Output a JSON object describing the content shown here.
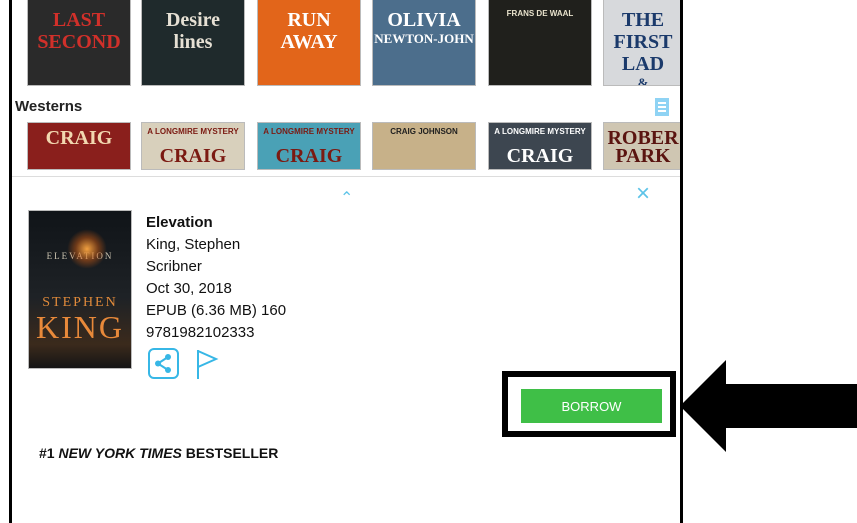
{
  "top_row": [
    {
      "lines": [
        "LAST",
        "SECOND"
      ],
      "bg": "#2a2a2a",
      "fg": "#d1302a"
    },
    {
      "lines": [
        "Desire",
        "lines"
      ],
      "bg": "#1f2a2c",
      "fg": "#e6e0d4"
    },
    {
      "lines": [
        "RUN",
        "AWAY"
      ],
      "bg": "#e2651a",
      "fg": "#ffffff"
    },
    {
      "lines": [
        "OLIVIA",
        "NEWTON-JOHN"
      ],
      "bg": "#4c6e8c",
      "fg": "#ffffff"
    },
    {
      "lines": [
        "FRANS DE WAAL"
      ],
      "bg": "#20201c",
      "fg": "#e8e2cc"
    },
    {
      "lines": [
        "THE",
        "FIRST",
        "LAD",
        "& BRENDAN"
      ],
      "bg": "#d7d9dc",
      "fg": "#1b3a6b"
    }
  ],
  "shelf": {
    "title": "Westerns"
  },
  "westerns": [
    {
      "lines": [
        "CRAIG"
      ],
      "bg": "#8a1f1c",
      "fg": "#f2d8b0"
    },
    {
      "lines": [
        "A LONGMIRE MYSTERY",
        "CRAIG"
      ],
      "bg": "#d8d0bc",
      "fg": "#7b1a12"
    },
    {
      "lines": [
        "A LONGMIRE MYSTERY",
        "CRAIG"
      ],
      "bg": "#4aa1b6",
      "fg": "#7b1a12"
    },
    {
      "lines": [
        "CRAIG JOHNSON"
      ],
      "bg": "#c7b189",
      "fg": "#1f1f1f"
    },
    {
      "lines": [
        "A LONGMIRE MYSTERY",
        "CRAIG"
      ],
      "bg": "#3d4650",
      "fg": "#ffffff"
    },
    {
      "lines": [
        "ROBER",
        "PARK"
      ],
      "bg": "#cfc6b2",
      "fg": "#5a1410"
    }
  ],
  "detail": {
    "cover_title": "ELEVATION",
    "cover_author_first": "STEPHEN",
    "cover_author_last": "KING",
    "title": "Elevation",
    "author": "King, Stephen",
    "publisher": "Scribner",
    "date": "Oct 30, 2018",
    "format": "EPUB (6.36 MB) 160",
    "isbn": "9781982102333",
    "share_icon": "share-icon",
    "flag_icon": "flag-icon"
  },
  "borrow_label": "BORROW",
  "blurb": {
    "prefix": "#1 ",
    "italic": "NEW YORK TIMES",
    "suffix": " BESTSELLER"
  },
  "colors": {
    "accent": "#37b7e6",
    "borrow": "#3fbf47",
    "highlight": "#000000"
  }
}
